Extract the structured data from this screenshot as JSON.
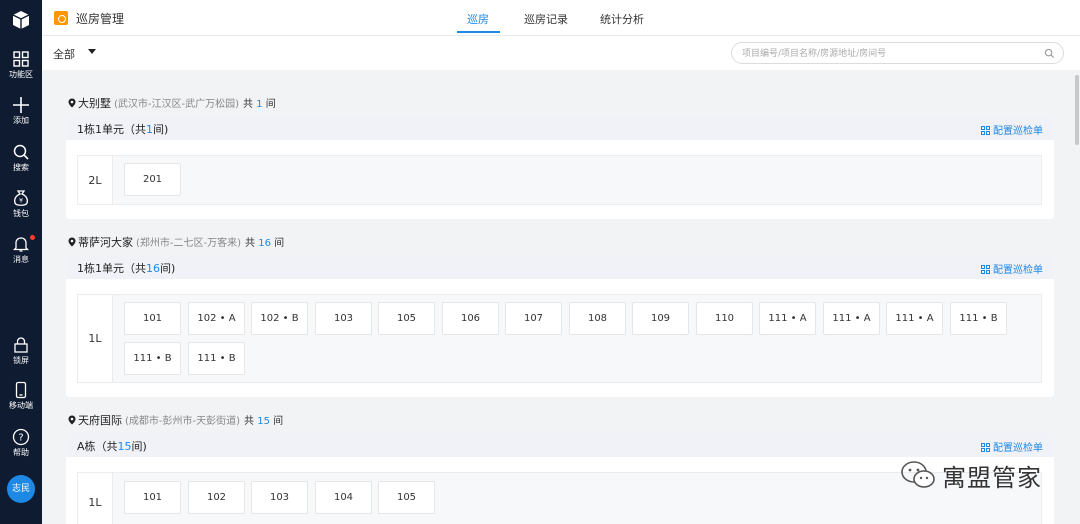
{
  "sidebar": {
    "items": [
      {
        "label": "功能区",
        "icon": "grid-icon"
      },
      {
        "label": "添加",
        "icon": "plus-icon"
      },
      {
        "label": "搜索",
        "icon": "search-icon"
      },
      {
        "label": "钱包",
        "icon": "wallet-icon"
      },
      {
        "label": "消息",
        "icon": "bell-icon"
      },
      {
        "label": "锁屏",
        "icon": "lock-icon"
      },
      {
        "label": "移动端",
        "icon": "mobile-icon"
      },
      {
        "label": "帮助",
        "icon": "help-icon"
      }
    ],
    "avatar": "志民"
  },
  "header": {
    "title": "巡房管理",
    "tabs": [
      {
        "label": "巡房",
        "active": true
      },
      {
        "label": "巡房记录",
        "active": false
      },
      {
        "label": "统计分析",
        "active": false
      }
    ]
  },
  "filter": {
    "selected": "全部",
    "search_placeholder": "项目编号/项目名称/房源地址/房间号"
  },
  "projects": [
    {
      "name": "大别墅",
      "address": "(武汉市-江汉区-武广万松园)",
      "count_prefix": "共",
      "count": "1",
      "count_suffix": "间",
      "buildings": [
        {
          "name_prefix": "1栋1单元（共",
          "count": "1",
          "name_suffix": "间)",
          "config_label": "配置巡检单",
          "floors": [
            {
              "label": "2L",
              "rooms": [
                "201"
              ]
            }
          ]
        }
      ]
    },
    {
      "name": "蒂萨河大家",
      "address": "(郑州市-二七区-万客来)",
      "count_prefix": "共",
      "count": "16",
      "count_suffix": "间",
      "buildings": [
        {
          "name_prefix": "1栋1单元（共",
          "count": "16",
          "name_suffix": "间)",
          "config_label": "配置巡检单",
          "floors": [
            {
              "label": "1L",
              "rooms": [
                "101",
                "102 • A",
                "102 • B",
                "103",
                "105",
                "106",
                "107",
                "108",
                "109",
                "110",
                "111 • A",
                "111 • A",
                "111 • A",
                "111 • B",
                "111 • B",
                "111 • B"
              ]
            }
          ]
        }
      ]
    },
    {
      "name": "天府国际",
      "address": "(成都市-彭州市-天彭街道)",
      "count_prefix": "共",
      "count": "15",
      "count_suffix": "间",
      "buildings": [
        {
          "name_prefix": "A栋（共",
          "count": "15",
          "name_suffix": "间)",
          "config_label": "配置巡检单",
          "floors": [
            {
              "label": "1L",
              "rooms": [
                "101",
                "102",
                "103",
                "104",
                "105"
              ]
            }
          ]
        }
      ]
    }
  ],
  "watermark": "寓盟管家",
  "colors": {
    "accent": "#1e88e5",
    "sidebar_bg": "#0f1b30",
    "app_icon": "#ff9800"
  }
}
